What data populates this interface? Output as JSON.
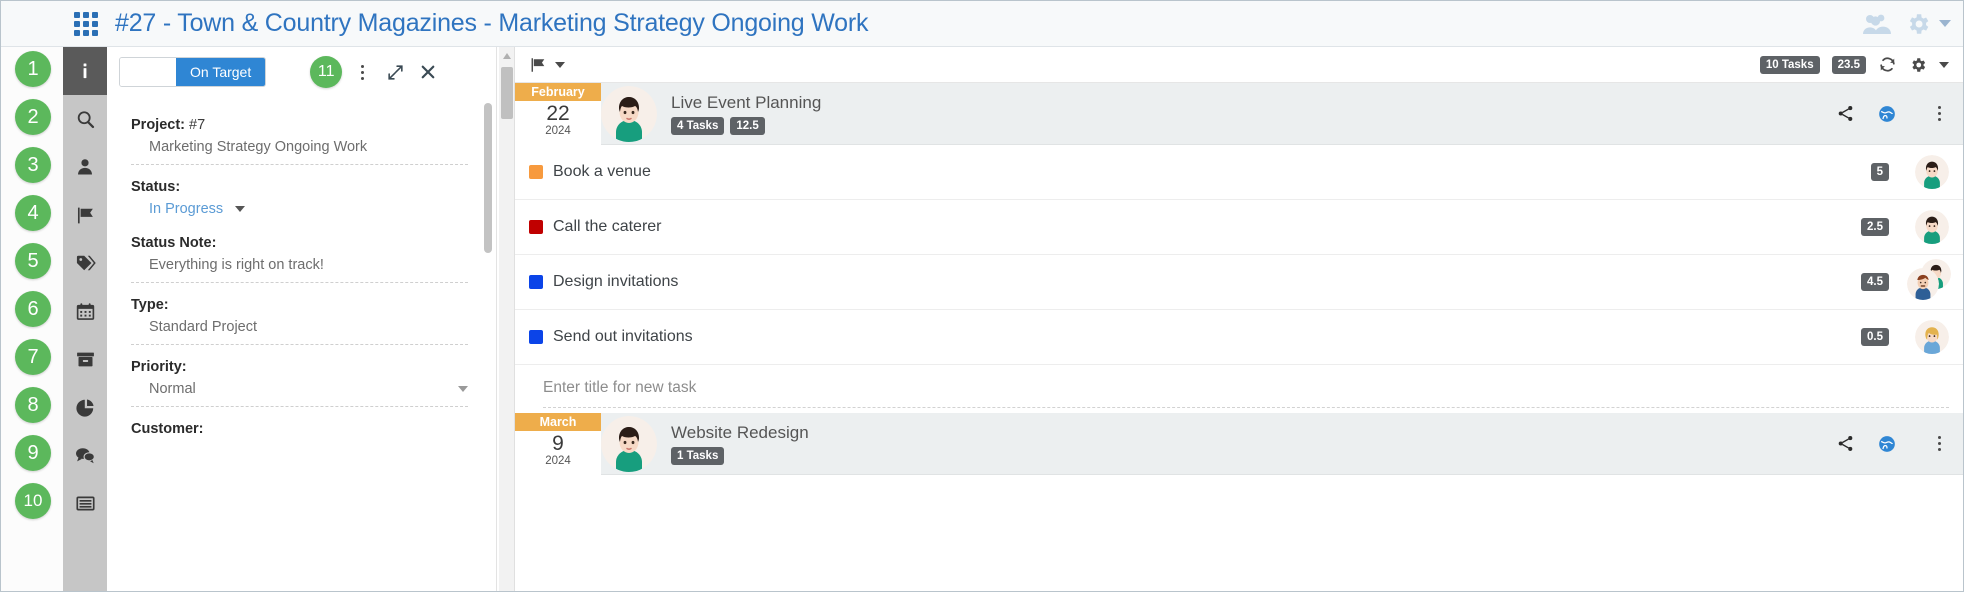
{
  "topbar": {
    "grid_icon": "grid-menu-icon",
    "title": "#27 - Town & Country Magazines - Marketing Strategy Ongoing Work",
    "people_icon": "people-icon",
    "gear_icon": "gear-icon",
    "caret_icon": "chevron-down-icon"
  },
  "step_badges": [
    "1",
    "2",
    "3",
    "4",
    "5",
    "6",
    "7",
    "8",
    "9",
    "10"
  ],
  "rail": [
    {
      "icon": "info-icon",
      "label": "Info",
      "active": true
    },
    {
      "icon": "search-icon",
      "label": "Search",
      "active": false
    },
    {
      "icon": "person-icon",
      "label": "People",
      "active": false
    },
    {
      "icon": "flag-icon",
      "label": "Flags",
      "active": false
    },
    {
      "icon": "tag-icon",
      "label": "Tags",
      "active": false
    },
    {
      "icon": "calendar-icon",
      "label": "Calendar",
      "active": false
    },
    {
      "icon": "archive-icon",
      "label": "Archive",
      "active": false
    },
    {
      "icon": "pie-chart-icon",
      "label": "Reports",
      "active": false
    },
    {
      "icon": "chat-icon",
      "label": "Comments",
      "active": false
    },
    {
      "icon": "list-icon",
      "label": "List",
      "active": false
    }
  ],
  "detail": {
    "status_toggle": {
      "blank_label": "",
      "on_target_label": "On Target"
    },
    "step_number": "11",
    "menu_icon": "kebab-menu-icon",
    "expand_icon": "expand-icon",
    "close_icon": "close-icon",
    "fields": [
      {
        "label": "Project:",
        "inline": "#7",
        "value": "Marketing Strategy Ongoing Work",
        "kind": "text"
      },
      {
        "label": "Status:",
        "inline": "",
        "value": "In Progress",
        "kind": "link-dropdown"
      },
      {
        "label": "Status Note:",
        "inline": "",
        "value": "Everything is right on track!",
        "kind": "text"
      },
      {
        "label": "Type:",
        "inline": "",
        "value": "Standard Project",
        "kind": "text"
      },
      {
        "label": "Priority:",
        "inline": "",
        "value": "Normal",
        "kind": "dropdown"
      },
      {
        "label": "Customer:",
        "inline": "",
        "value": "",
        "kind": "text"
      }
    ]
  },
  "tasks_panel": {
    "flag_filter_icon": "flag-icon",
    "flag_caret_icon": "chevron-down-icon",
    "task_count_pill": "10 Tasks",
    "hours_pill": "23.5",
    "refresh_icon": "refresh-icon",
    "settings_icon": "gear-icon",
    "settings_caret_icon": "chevron-down-icon",
    "new_task_placeholder": "Enter title for new task",
    "groups": [
      {
        "month": "February",
        "day": "22",
        "year": "2024",
        "avatar": "female-dark-hair",
        "title": "Live Event Planning",
        "task_pill": "4 Tasks",
        "hours_pill": "12.5",
        "share_icon": "share-icon",
        "globe_icon": "globe-icon",
        "menu_icon": "kebab-menu-icon",
        "tasks": [
          {
            "color": "#f79a3e",
            "title": "Book a venue",
            "hours": "5",
            "avatars": [
              "female-dark-hair"
            ]
          },
          {
            "color": "#c00000",
            "title": "Call the caterer",
            "hours": "2.5",
            "avatars": [
              "female-dark-hair"
            ]
          },
          {
            "color": "#0b44e8",
            "title": "Design invitations",
            "hours": "4.5",
            "avatars": [
              "male-mustache",
              "female-dark-hair"
            ]
          },
          {
            "color": "#0b44e8",
            "title": "Send out invitations",
            "hours": "0.5",
            "avatars": [
              "female-blonde"
            ]
          }
        ]
      },
      {
        "month": "March",
        "day": "9",
        "year": "2024",
        "avatar": "female-dark-hair",
        "title": "Website Redesign",
        "task_pill": "1 Tasks",
        "hours_pill": "",
        "share_icon": "share-icon",
        "globe_icon": "globe-icon",
        "menu_icon": "kebab-menu-icon",
        "tasks": []
      }
    ]
  },
  "colors": {
    "accent_blue": "#2f74c0",
    "badge_green": "#5cb85c",
    "pill_gray": "#5e6266",
    "month_orange": "#eead4b",
    "rail_gray": "#c6c6c6"
  }
}
